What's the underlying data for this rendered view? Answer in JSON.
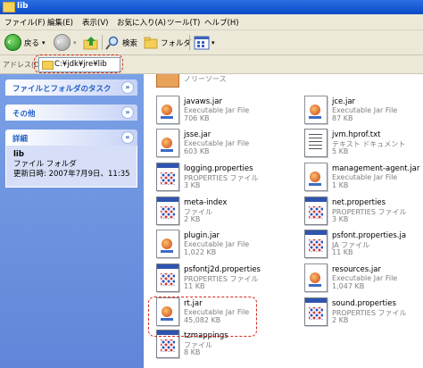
{
  "window": {
    "title": "lib"
  },
  "menu": [
    "ファイル(F)",
    "編集(E)",
    "表示(V)",
    "お気に入り(A)",
    "ツール(T)",
    "ヘルプ(H)"
  ],
  "toolbar": {
    "back_label": "戻る",
    "search_label": "検索",
    "folders_label": "フォルダ"
  },
  "address": {
    "label": "アドレス(D)",
    "path": "C:¥jdk¥jre¥lib"
  },
  "taskpane": {
    "file_tasks": "ファイルとフォルダのタスク",
    "other": "その他",
    "details": "詳細",
    "detail_name": "lib",
    "detail_type": "ファイル フォルダ",
    "detail_updated": "更新日時: 2007年7月9日、11:35"
  },
  "partial_item": {
    "text": "ノリーソース"
  },
  "files": [
    {
      "name": "javaws.jar",
      "type": "Executable Jar File",
      "size": "706 KB",
      "icon": "jar-icon"
    },
    {
      "name": "jce.jar",
      "type": "Executable Jar File",
      "size": "87 KB",
      "icon": "jar-icon"
    },
    {
      "name": "jsse.jar",
      "type": "Executable Jar File",
      "size": "603 KB",
      "icon": "jar-icon"
    },
    {
      "name": "jvm.hprof.txt",
      "type": "テキスト ドキュメント",
      "size": "5 KB",
      "icon": "text-file-icon"
    },
    {
      "name": "logging.properties",
      "type": "PROPERTIES ファイル",
      "size": "3 KB",
      "icon": "properties-icon"
    },
    {
      "name": "management-agent.jar",
      "type": "Executable Jar File",
      "size": "1 KB",
      "icon": "jar-icon"
    },
    {
      "name": "meta-index",
      "type": "ファイル",
      "size": "2 KB",
      "icon": "file-icon"
    },
    {
      "name": "net.properties",
      "type": "PROPERTIES ファイル",
      "size": "3 KB",
      "icon": "properties-icon"
    },
    {
      "name": "plugin.jar",
      "type": "Executable Jar File",
      "size": "1,022 KB",
      "icon": "jar-icon"
    },
    {
      "name": "psfont.properties.ja",
      "type": "JA ファイル",
      "size": "11 KB",
      "icon": "file-icon"
    },
    {
      "name": "psfontj2d.properties",
      "type": "PROPERTIES ファイル",
      "size": "11 KB",
      "icon": "properties-icon"
    },
    {
      "name": "resources.jar",
      "type": "Executable Jar File",
      "size": "1,047 KB",
      "icon": "jar-icon"
    },
    {
      "name": "rt.jar",
      "type": "Executable Jar File",
      "size": "45,082 KB",
      "icon": "jar-icon"
    },
    {
      "name": "sound.properties",
      "type": "PROPERTIES ファイル",
      "size": "2 KB",
      "icon": "properties-icon"
    },
    {
      "name": "tzmappings",
      "type": "ファイル",
      "size": "8 KB",
      "icon": "file-icon"
    }
  ]
}
